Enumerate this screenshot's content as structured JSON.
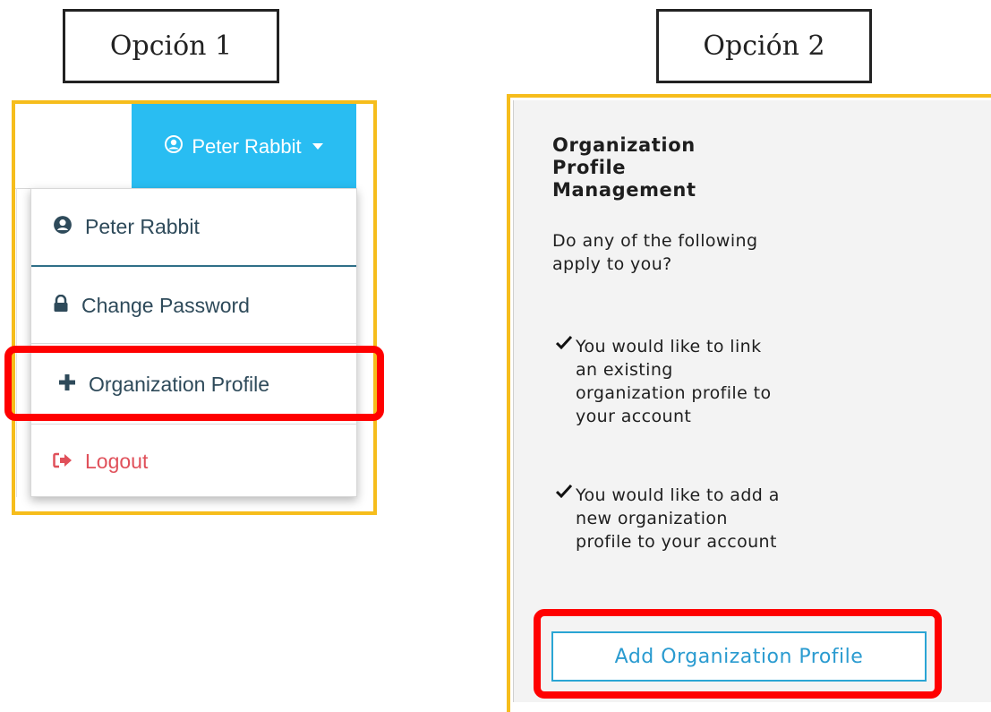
{
  "labels": {
    "option1": "Opción 1",
    "option2": "Opción 2"
  },
  "option1": {
    "trigger_label": "Peter Rabbit",
    "menu": [
      {
        "label": "Peter Rabbit",
        "icon": "user-circle-icon"
      },
      {
        "label": "Change Password",
        "icon": "lock-icon"
      },
      {
        "label": "Organization Profile",
        "icon": "plus-icon"
      },
      {
        "label": "Logout",
        "icon": "sign-out-icon"
      }
    ]
  },
  "option2": {
    "title": "Organization Profile Management",
    "intro": "Do any of the following apply to you?",
    "bullets": [
      "You would like to link an existing organization profile to your account",
      "You would like to add a new organization profile to your account"
    ],
    "button_label": "Add Organization Profile"
  },
  "colors": {
    "frame": "#f6bd1c",
    "highlight": "#ff0000",
    "trigger_bg": "#29bdf2",
    "logout": "#e0505a",
    "button": "#2a9bd0"
  }
}
